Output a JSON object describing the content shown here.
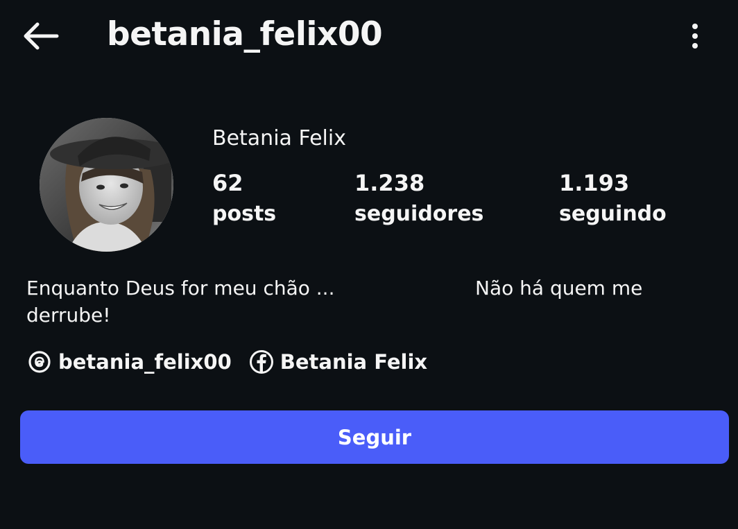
{
  "header": {
    "back_icon": "arrow-left-icon",
    "username": "betania_felix00",
    "more_icon": "more-vertical-icon"
  },
  "profile": {
    "display_name": "Betania Felix",
    "avatar": "profile-photo"
  },
  "stats": [
    {
      "value": "62",
      "label": "posts"
    },
    {
      "value": "1.238",
      "label": "seguidores"
    },
    {
      "value": "1.193",
      "label": "seguindo"
    }
  ],
  "bio": {
    "line1_left": "Enquanto Deus for meu chão ...",
    "line1_right": "Não há quem me",
    "line2": "derrube!"
  },
  "links": [
    {
      "icon": "threads-icon",
      "label": "betania_felix00"
    },
    {
      "icon": "facebook-icon",
      "label": "Betania Felix"
    }
  ],
  "actions": {
    "follow_label": "Seguir"
  },
  "colors": {
    "background": "#0c1014",
    "text": "#f5f5f5",
    "follow_button": "#4a5df9"
  }
}
